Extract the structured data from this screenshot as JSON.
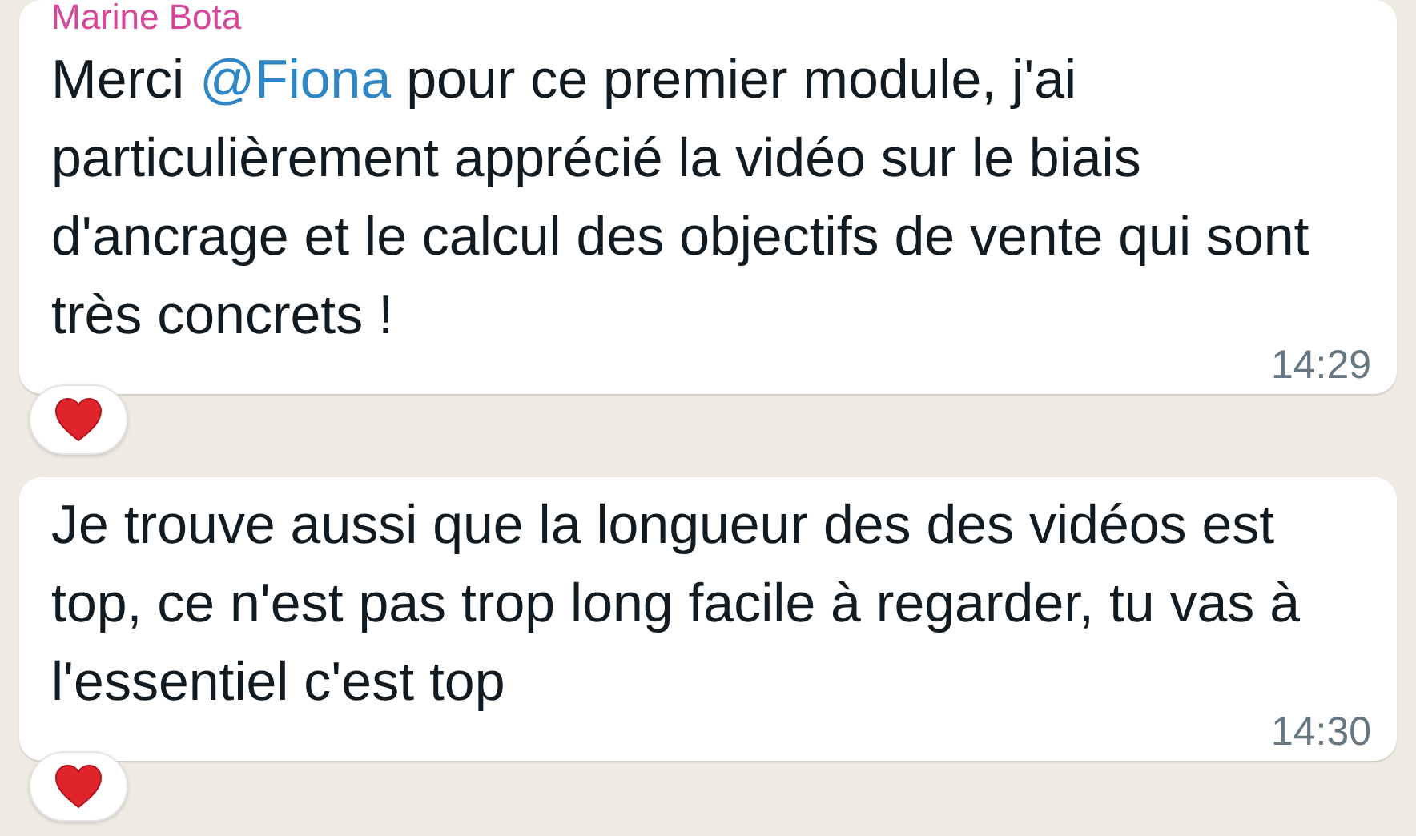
{
  "messages": [
    {
      "sender": "Marine Bota",
      "parts": [
        {
          "kind": "text",
          "text": "Merci "
        },
        {
          "kind": "mention",
          "text": "@Fiona"
        },
        {
          "kind": "text",
          "text": " pour ce premier module, j'ai particulièrement apprécié la vidéo sur le biais d'ancrage et le calcul des objectifs de vente qui sont très concrets !"
        }
      ],
      "time": "14:29",
      "reaction": {
        "kind": "heart"
      }
    },
    {
      "parts": [
        {
          "kind": "text",
          "text": "Je trouve aussi que la longueur des des vidéos est top, ce n'est pas trop long facile à regarder, tu vas à l'essentiel c'est top"
        }
      ],
      "time": "14:30",
      "reaction": {
        "kind": "heart"
      }
    }
  ]
}
